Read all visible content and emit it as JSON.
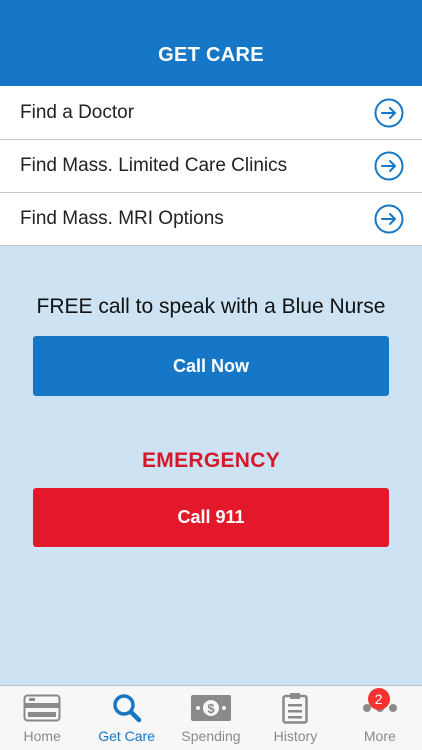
{
  "header": {
    "title": "GET CARE"
  },
  "menu": {
    "items": [
      {
        "label": "Find a Doctor"
      },
      {
        "label": "Find Mass. Limited Care Clinics"
      },
      {
        "label": "Find Mass. MRI Options"
      }
    ]
  },
  "nurse": {
    "text": "FREE call to speak with a Blue Nurse",
    "button": "Call Now"
  },
  "emergency": {
    "title": "EMERGENCY",
    "button": "Call 911"
  },
  "tabbar": {
    "tabs": [
      {
        "label": "Home",
        "icon": "card-icon"
      },
      {
        "label": "Get Care",
        "icon": "search-icon"
      },
      {
        "label": "Spending",
        "icon": "dollar-bill-icon"
      },
      {
        "label": "History",
        "icon": "clipboard-icon"
      },
      {
        "label": "More",
        "icon": "more-dots-icon"
      }
    ],
    "active": "Get Care",
    "badge": "2"
  },
  "colors": {
    "brand_blue": "#1677c7",
    "emergency_red": "#e3182b",
    "background": "#cde3f3"
  }
}
